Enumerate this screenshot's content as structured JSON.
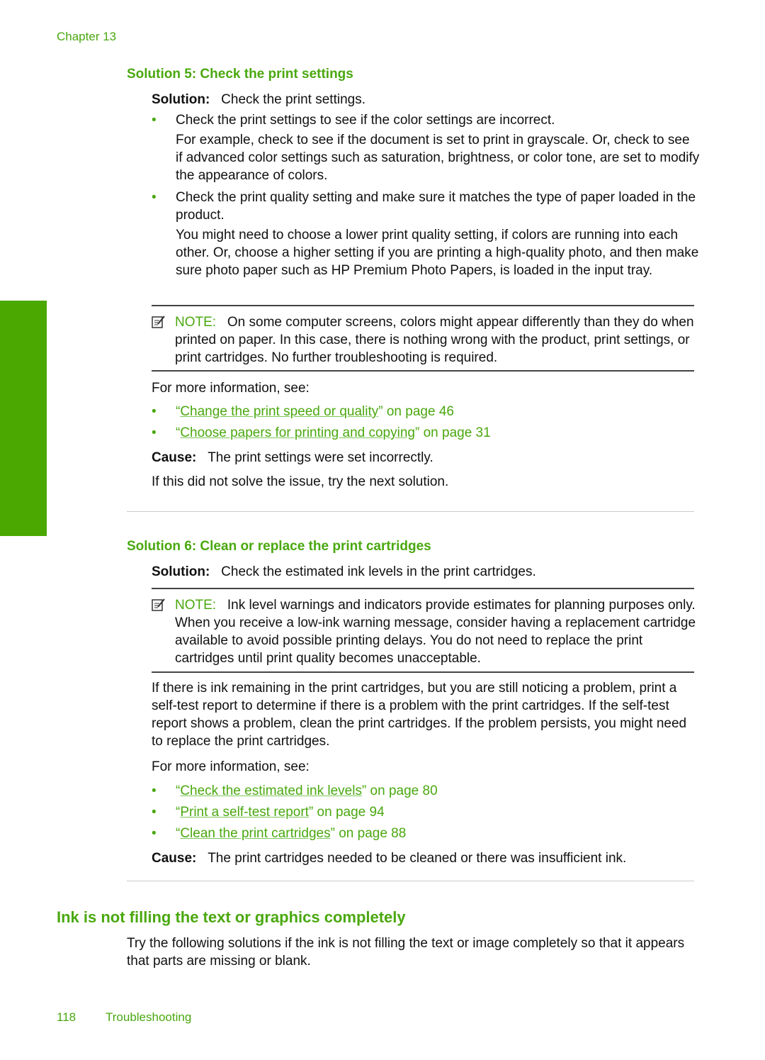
{
  "header": {
    "chapter": "Chapter 13"
  },
  "side_tab": {
    "label": "Troubleshooting",
    "color": "#4aa800"
  },
  "solution5": {
    "title": "Solution 5: Check the print settings",
    "solution_label": "Solution:",
    "solution_text": "Check the print settings.",
    "bullets": [
      {
        "text": "Check the print settings to see if the color settings are incorrect.",
        "detail": "For example, check to see if the document is set to print in grayscale. Or, check to see if advanced color settings such as saturation, brightness, or color tone, are set to modify the appearance of colors."
      },
      {
        "text": "Check the print quality setting and make sure it matches the type of paper loaded in the product.",
        "detail": "You might need to choose a lower print quality setting, if colors are running into each other. Or, choose a higher setting if you are printing a high-quality photo, and then make sure photo paper such as HP Premium Photo Papers, is loaded in the input tray."
      }
    ],
    "note_label": "NOTE:",
    "note_text": "On some computer screens, colors might appear differently than they do when printed on paper. In this case, there is nothing wrong with the product, print settings, or print cartridges. No further troubleshooting is required.",
    "more_info": "For more information, see:",
    "links": [
      {
        "text": "Change the print speed or quality",
        "suffix": "” on page 46"
      },
      {
        "text": "Choose papers for printing and copying",
        "suffix": "” on page 31"
      }
    ],
    "cause_label": "Cause:",
    "cause_text": "The print settings were set incorrectly.",
    "next": "If this did not solve the issue, try the next solution."
  },
  "solution6": {
    "title": "Solution 6: Clean or replace the print cartridges",
    "solution_label": "Solution:",
    "solution_text": "Check the estimated ink levels in the print cartridges.",
    "note_label": "NOTE:",
    "note_text": "Ink level warnings and indicators provide estimates for planning purposes only. When you receive a low-ink warning message, consider having a replacement cartridge available to avoid possible printing delays. You do not need to replace the print cartridges until print quality becomes unacceptable.",
    "body": "If there is ink remaining in the print cartridges, but you are still noticing a problem, print a self-test report to determine if there is a problem with the print cartridges. If the self-test report shows a problem, clean the print cartridges. If the problem persists, you might need to replace the print cartridges.",
    "more_info": "For more information, see:",
    "links": [
      {
        "text": "Check the estimated ink levels",
        "suffix": "” on page 80"
      },
      {
        "text": "Print a self-test report",
        "suffix": "” on page 94"
      },
      {
        "text": "Clean the print cartridges",
        "suffix": "” on page 88"
      }
    ],
    "cause_label": "Cause:",
    "cause_text": "The print cartridges needed to be cleaned or there was insufficient ink."
  },
  "section": {
    "title": "Ink is not filling the text or graphics completely",
    "intro": "Try the following solutions if the ink is not filling the text or image completely so that it appears that parts are missing or blank."
  },
  "footer": {
    "page_number": "118",
    "section": "Troubleshooting"
  },
  "bullet_glyph": "•",
  "open_quote": "“"
}
